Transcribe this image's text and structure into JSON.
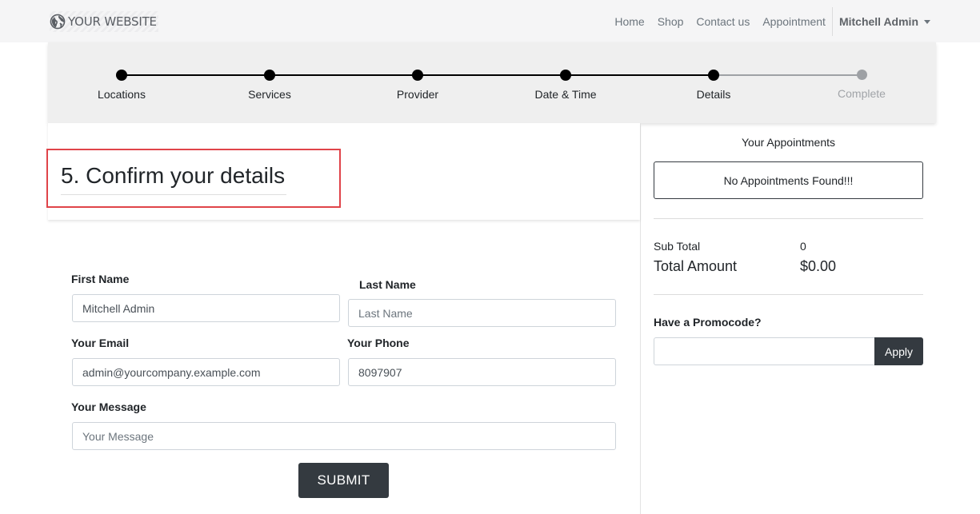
{
  "navbar": {
    "brand": "YOUR WEBSITE",
    "brand_icon": "globe-icon",
    "links": [
      "Home",
      "Shop",
      "Contact us",
      "Appointment"
    ],
    "user": "Mitchell Admin"
  },
  "steps": [
    {
      "label": "Locations",
      "state": "done"
    },
    {
      "label": "Services",
      "state": "done"
    },
    {
      "label": "Provider",
      "state": "done"
    },
    {
      "label": "Date & Time",
      "state": "done"
    },
    {
      "label": "Details",
      "state": "current"
    },
    {
      "label": "Complete",
      "state": "pending"
    }
  ],
  "form": {
    "title": "5. Confirm your details",
    "first_name": {
      "label": "First Name",
      "value": "Mitchell Admin",
      "placeholder": ""
    },
    "last_name": {
      "label": "Last Name",
      "value": "",
      "placeholder": "Last Name"
    },
    "email": {
      "label": "Your Email",
      "value": "admin@yourcompany.example.com",
      "placeholder": ""
    },
    "phone": {
      "label": "Your Phone",
      "value": "8097907",
      "placeholder": ""
    },
    "message": {
      "label": "Your Message",
      "value": "",
      "placeholder": "Your Message"
    },
    "submit": "SUBMIT"
  },
  "sidebar": {
    "title": "Your Appointments",
    "empty": "No Appointments Found!!!",
    "subtotal_label": "Sub Total",
    "subtotal_value": "0",
    "total_label": "Total Amount",
    "total_value": "$0.00",
    "promo_label": "Have a Promocode?",
    "promo_value": "",
    "apply": "Apply"
  },
  "colors": {
    "navbar_bg": "#f5f5f6",
    "step_done": "#000000",
    "step_pending": "#9ea1a5",
    "button_dark": "#343a40",
    "highlight_border": "#e04449"
  }
}
